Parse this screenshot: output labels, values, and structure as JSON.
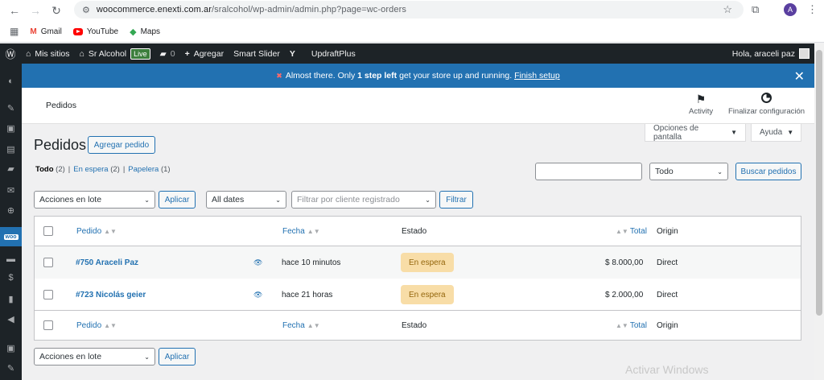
{
  "browser": {
    "url_host": "woocommerce.enexti.com.ar",
    "url_path": "/sralcohol/wp-admin/admin.php?page=wc-orders",
    "avatar_letter": "A",
    "bookmarks": [
      {
        "label": "Gmail"
      },
      {
        "label": "YouTube"
      },
      {
        "label": "Maps"
      }
    ]
  },
  "adminbar": {
    "my_sites": "Mis sitios",
    "site_name": "Sr Alcohol",
    "live": "Live",
    "comments": "0",
    "new": "Agregar",
    "smart_slider": "Smart Slider",
    "updraft": "UpdraftPlus",
    "greeting": "Hola, araceli paz"
  },
  "notice": {
    "text_a": "Almost there. Only ",
    "text_b": "1 step left",
    "text_c": " get your store up and running. ",
    "link": "Finish setup"
  },
  "header": {
    "title": "Pedidos",
    "activity": "Activity",
    "finish": "Finalizar configuración"
  },
  "screen": {
    "options": "Opciones de pantalla",
    "help": "Ayuda"
  },
  "page": {
    "title": "Pedidos",
    "add_order": "Agregar pedido",
    "views": {
      "all": "Todo",
      "all_count": "(2)",
      "sep1": "|",
      "onhold": "En espera",
      "onhold_count": "(2)",
      "sep2": "|",
      "trash": "Papelera",
      "trash_count": "(1)"
    },
    "search_status": "Todo",
    "search_button": "Buscar pedidos",
    "bulk_actions": "Acciones en lote",
    "apply": "Aplicar",
    "dates": "All dates",
    "customer_placeholder": "Filtrar por cliente registrado",
    "filter": "Filtrar"
  },
  "table": {
    "col_order": "Pedido",
    "col_date": "Fecha",
    "col_status": "Estado",
    "col_total": "Total",
    "col_origin": "Origin",
    "rows": [
      {
        "order": "#750 Araceli Paz",
        "date": "hace 10 minutos",
        "status": "En espera",
        "total": "$ 8.000,00",
        "origin": "Direct"
      },
      {
        "order": "#723 Nicolás geier",
        "date": "hace 21 horas",
        "status": "En espera",
        "total": "$ 2.000,00",
        "origin": "Direct"
      }
    ]
  },
  "watermark": "Activar Windows"
}
